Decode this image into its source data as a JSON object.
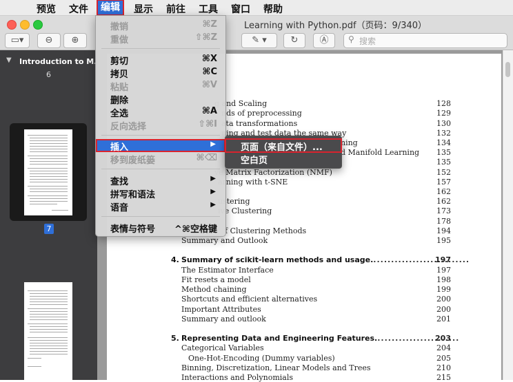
{
  "menubar": {
    "apple": "",
    "items": [
      "预览",
      "文件",
      "编辑",
      "显示",
      "前往",
      "工具",
      "窗口",
      "帮助"
    ],
    "active": "编辑"
  },
  "window": {
    "title": "Learning with Python.pdf（页码：9/340）",
    "search_placeholder": "搜索"
  },
  "sidebar": {
    "title": "Introduction to M...",
    "prev_page": "6",
    "current_page": "7"
  },
  "edit_menu": {
    "items": [
      {
        "label": "撤销",
        "shortcut": "⌘Z",
        "disabled": true
      },
      {
        "label": "重做",
        "shortcut": "⇧⌘Z",
        "disabled": true
      },
      {
        "label": "剪切",
        "shortcut": "⌘X",
        "disabled": false
      },
      {
        "label": "拷贝",
        "shortcut": "⌘C",
        "disabled": false
      },
      {
        "label": "粘贴",
        "shortcut": "⌘V",
        "disabled": true
      },
      {
        "label": "删除",
        "shortcut": "",
        "disabled": false
      },
      {
        "label": "全选",
        "shortcut": "⌘A",
        "disabled": false
      },
      {
        "label": "反向选择",
        "shortcut": "⇧⌘I",
        "disabled": true
      },
      {
        "label": "插入",
        "shortcut": "",
        "disabled": false,
        "submenu": true,
        "selected": true
      },
      {
        "label": "移到废纸篓",
        "shortcut": "⌘⌫",
        "disabled": true
      },
      {
        "label": "查找",
        "shortcut": "",
        "disabled": false,
        "submenu": true
      },
      {
        "label": "拼写和语法",
        "shortcut": "",
        "disabled": false,
        "submenu": true
      },
      {
        "label": "语音",
        "shortcut": "",
        "disabled": false,
        "submenu": true
      },
      {
        "label": "表情与符号",
        "shortcut": "^⌘空格键",
        "disabled": false
      }
    ]
  },
  "insert_submenu": {
    "items": [
      "页面（来自文件）...",
      "空白页"
    ]
  },
  "toc": {
    "lines": [
      {
        "text": "g and Scaling",
        "page": "128"
      },
      {
        "text": "nds of preprocessing",
        "page": "129"
      },
      {
        "text": "ata transformations",
        "page": "130"
      },
      {
        "text": "ning and test data the same way",
        "page": "132"
      },
      {
        "text": "ning",
        "page": "134"
      },
      {
        "text": "d Manifold Learning",
        "page": "135"
      },
      {
        "text": "",
        "page": "135"
      },
      {
        "text": "ve Matrix Factorization (NMF)",
        "page": "152"
      },
      {
        "text": "arning with t-SNE",
        "page": "157"
      },
      {
        "text": "",
        "page": "162"
      },
      {
        "text": "ustering",
        "page": "162"
      },
      {
        "text": "ive Clustering",
        "page": "173"
      },
      {
        "text": "",
        "page": "178"
      },
      {
        "text": "f Clustering Methods",
        "page": "194"
      },
      {
        "text": "Summary and Outlook",
        "page": "195"
      }
    ],
    "chapter4": {
      "num": "4.",
      "title": "Summary of scikit-learn methods and usage.",
      "page": "197"
    },
    "ch4_items": [
      {
        "text": "The Estimator Interface",
        "page": "197"
      },
      {
        "text": "Fit resets a model",
        "page": "198"
      },
      {
        "text": "Method chaining",
        "page": "199"
      },
      {
        "text": "Shortcuts and efficient alternatives",
        "page": "200"
      },
      {
        "text": "Important Attributes",
        "page": "200"
      },
      {
        "text": "Summary and outlook",
        "page": "201"
      }
    ],
    "chapter5": {
      "num": "5.",
      "title": "Representing Data and Engineering Features.",
      "page": "203"
    },
    "ch5_items": [
      {
        "text": "Categorical Variables",
        "page": "204"
      },
      {
        "text": "One-Hot-Encoding (Dummy variables)",
        "page": "205"
      },
      {
        "text": "Binning, Discretization, Linear Models and Trees",
        "page": "210"
      },
      {
        "text": "Interactions and Polynomials",
        "page": "215"
      }
    ]
  }
}
